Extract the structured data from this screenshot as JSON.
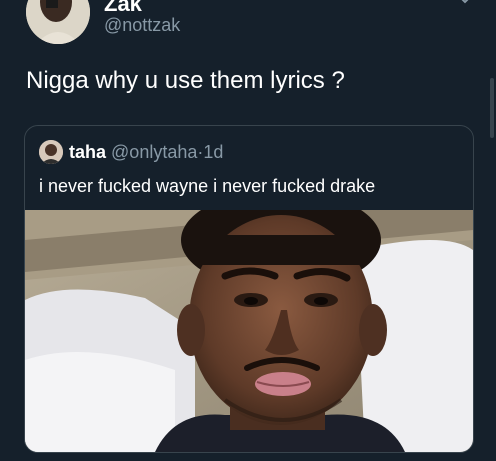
{
  "author": {
    "display_name": "Zak",
    "handle": "@nottzak"
  },
  "tweet": {
    "text": "Nigga why u use them lyrics ?"
  },
  "quoted_tweet": {
    "display_name": "taha",
    "handle": "@onlytaha",
    "separator": "·",
    "time": "1d",
    "text": "i never fucked wayne i never fucked drake"
  },
  "icons": {
    "menu_caret": "chevron-down-icon"
  },
  "colors": {
    "background": "#15202b",
    "secondary_text": "#8899a6",
    "border": "#38444d"
  }
}
